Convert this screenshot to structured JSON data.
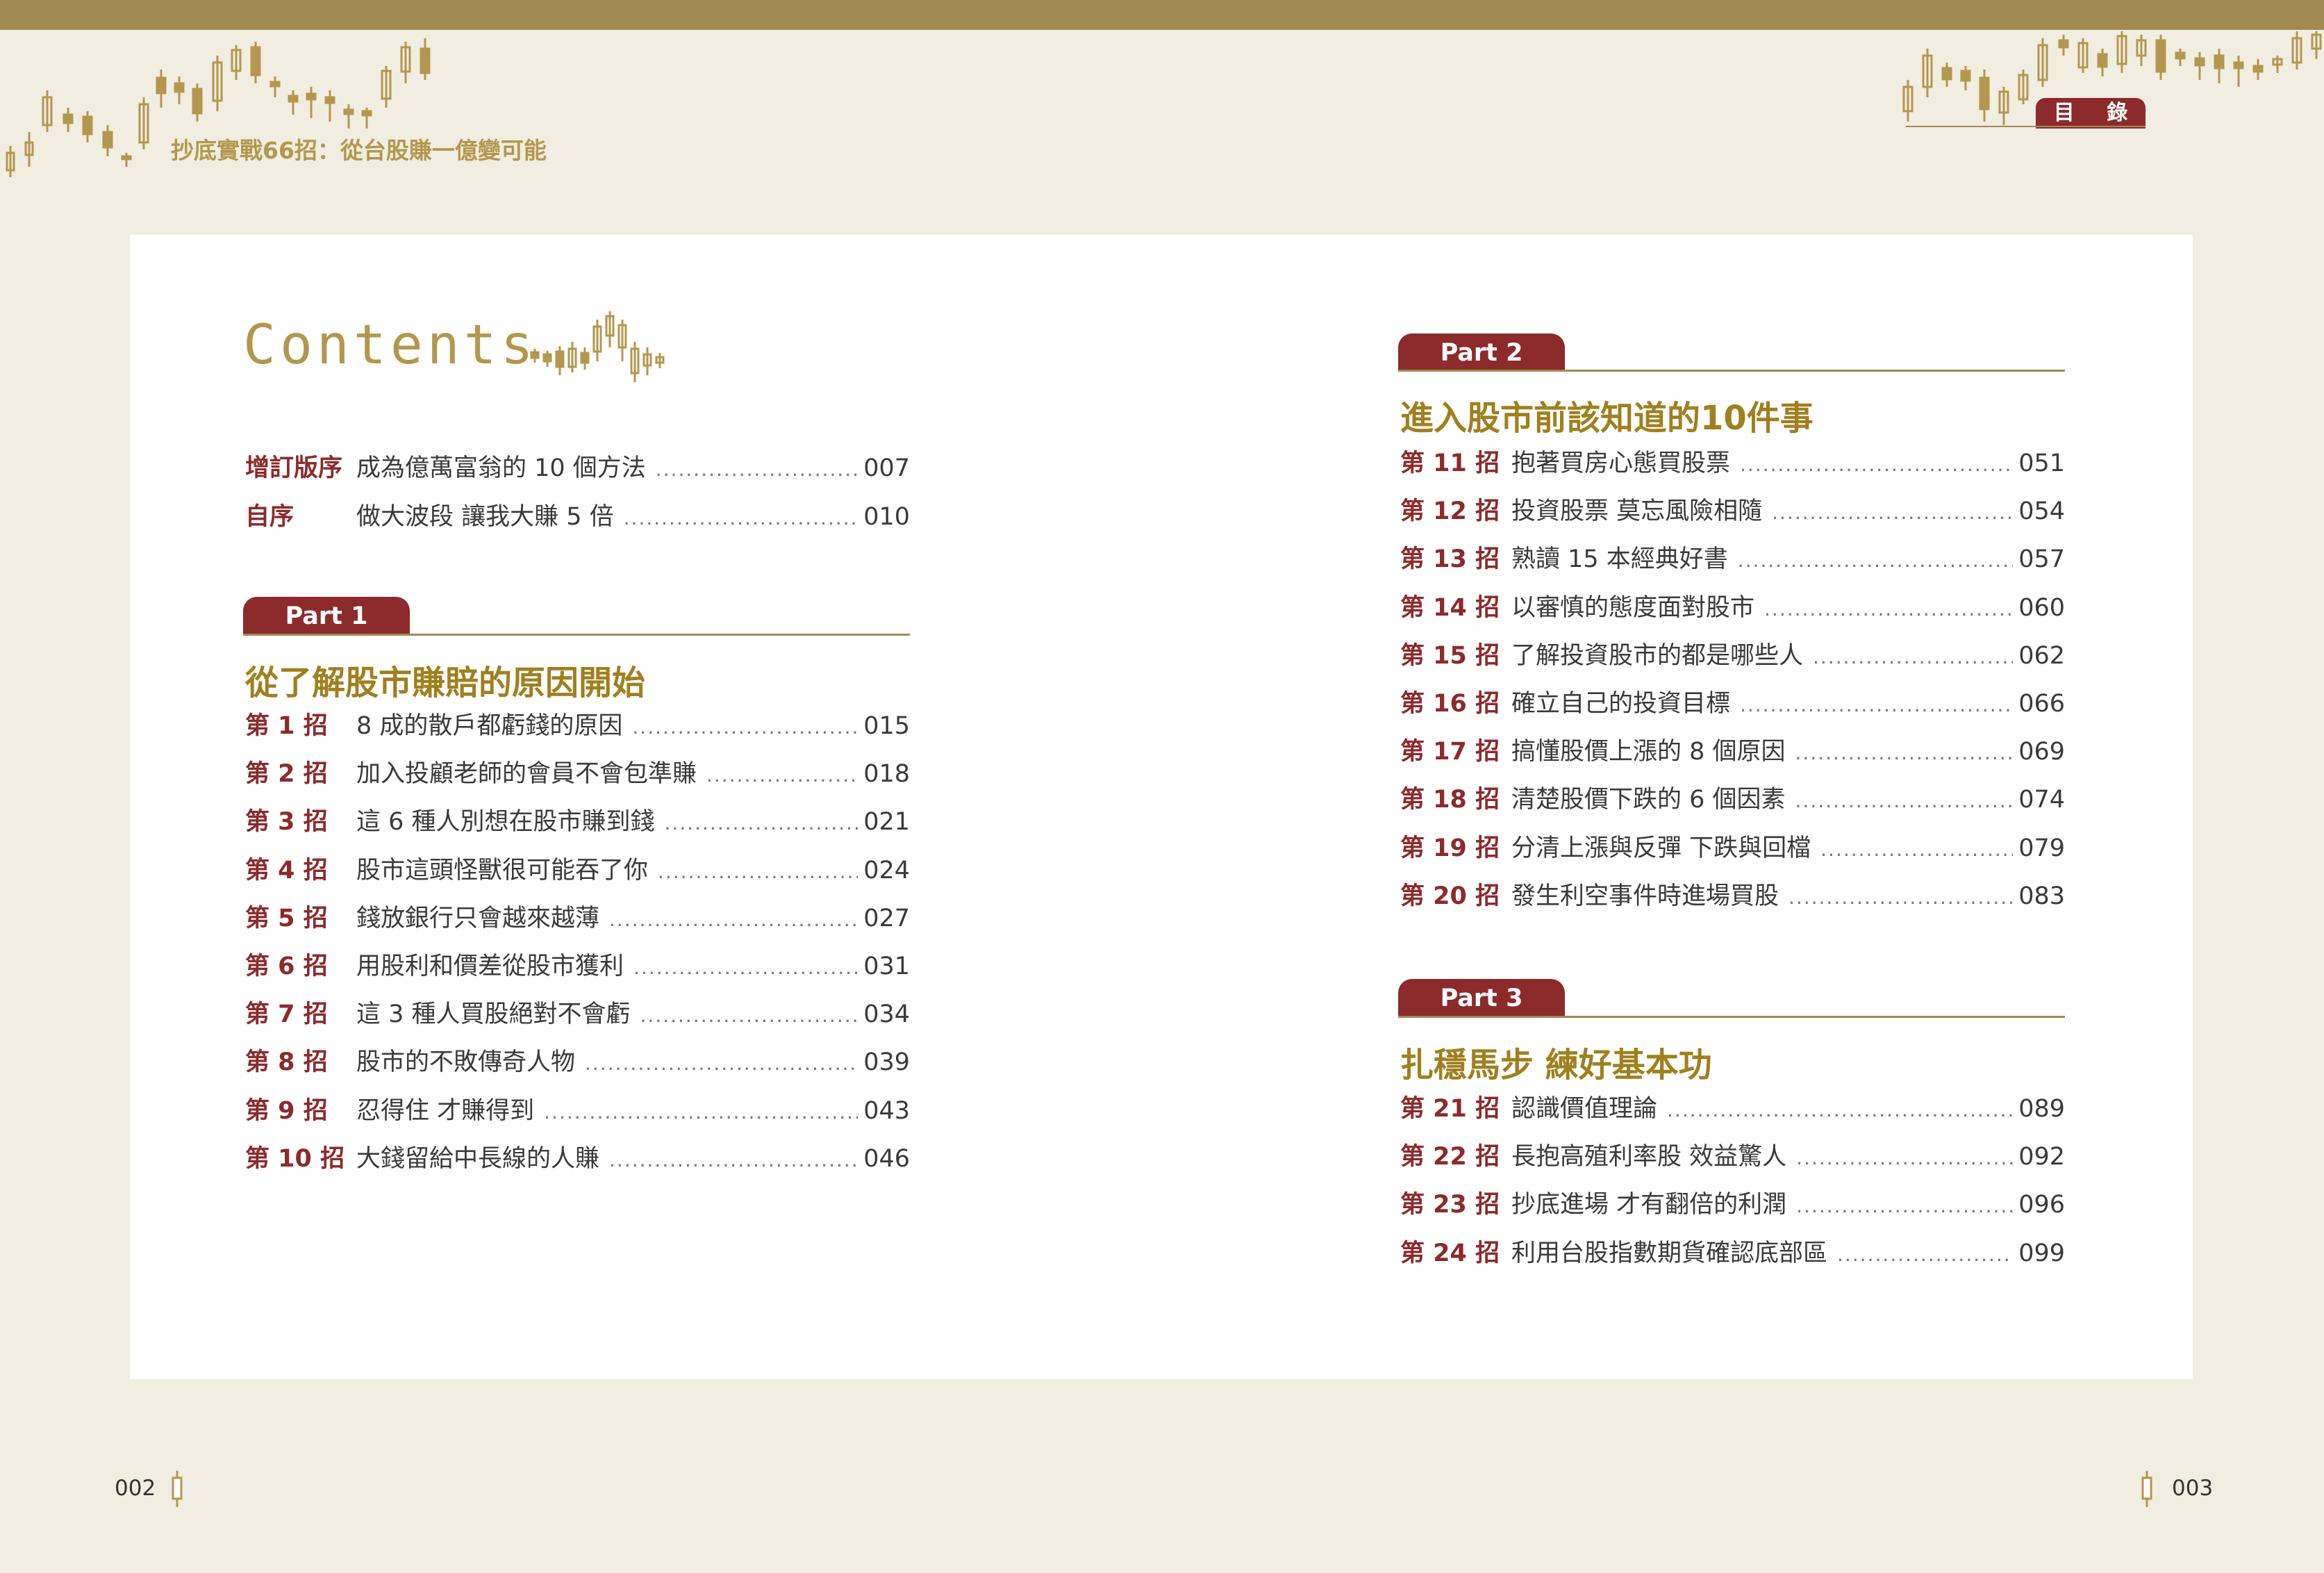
{
  "header": {
    "book_title": "抄底實戰66招：從台股賺一億變可能",
    "section_label": "目 錄"
  },
  "contents_title": "Contents",
  "preface": [
    {
      "label": "增訂版序",
      "title": "成為億萬富翁的 10 個方法",
      "page": "007"
    },
    {
      "label": "自序",
      "title": "做大波段 讓我大賺 5 倍",
      "page": "010"
    }
  ],
  "parts": [
    {
      "tab": "Part 1",
      "title": "從了解股市賺賠的原因開始",
      "entries": [
        {
          "label": "第 1 招",
          "title": "8 成的散戶都虧錢的原因",
          "page": "015"
        },
        {
          "label": "第 2 招",
          "title": "加入投顧老師的會員不會包準賺",
          "page": "018"
        },
        {
          "label": "第 3 招",
          "title": "這 6 種人別想在股市賺到錢",
          "page": "021"
        },
        {
          "label": "第 4 招",
          "title": "股市這頭怪獸很可能吞了你",
          "page": "024"
        },
        {
          "label": "第 5 招",
          "title": "錢放銀行只會越來越薄",
          "page": "027"
        },
        {
          "label": "第 6 招",
          "title": "用股利和價差從股市獲利",
          "page": "031"
        },
        {
          "label": "第 7 招",
          "title": "這 3 種人買股絕對不會虧",
          "page": "034"
        },
        {
          "label": "第 8 招",
          "title": "股市的不敗傳奇人物",
          "page": "039"
        },
        {
          "label": "第 9 招",
          "title": "忍得住 才賺得到",
          "page": "043"
        },
        {
          "label": "第 10 招",
          "title": "大錢留給中長線的人賺",
          "page": "046"
        }
      ]
    },
    {
      "tab": "Part 2",
      "title": "進入股市前該知道的10件事",
      "entries": [
        {
          "label": "第 11 招",
          "title": "抱著買房心態買股票",
          "page": "051"
        },
        {
          "label": "第 12 招",
          "title": "投資股票 莫忘風險相隨",
          "page": "054"
        },
        {
          "label": "第 13 招",
          "title": "熟讀 15 本經典好書",
          "page": "057"
        },
        {
          "label": "第 14 招",
          "title": "以審慎的態度面對股市",
          "page": "060"
        },
        {
          "label": "第 15 招",
          "title": "了解投資股市的都是哪些人",
          "page": "062"
        },
        {
          "label": "第 16 招",
          "title": "確立自己的投資目標",
          "page": "066"
        },
        {
          "label": "第 17 招",
          "title": "搞懂股價上漲的 8 個原因",
          "page": "069"
        },
        {
          "label": "第 18 招",
          "title": "清楚股價下跌的 6 個因素",
          "page": "074"
        },
        {
          "label": "第 19 招",
          "title": "分清上漲與反彈 下跌與回檔",
          "page": "079"
        },
        {
          "label": "第 20 招",
          "title": "發生利空事件時進場買股",
          "page": "083"
        }
      ]
    },
    {
      "tab": "Part 3",
      "title": "扎穩馬步 練好基本功",
      "entries": [
        {
          "label": "第 21 招",
          "title": "認識價值理論",
          "page": "089"
        },
        {
          "label": "第 22 招",
          "title": "長抱高殖利率股 效益驚人",
          "page": "092"
        },
        {
          "label": "第 23 招",
          "title": "抄底進場 才有翻倍的利潤",
          "page": "096"
        },
        {
          "label": "第 24 招",
          "title": "利用台股指數期貨確認底部區",
          "page": "099"
        }
      ]
    }
  ],
  "folios": {
    "left": "002",
    "right": "003"
  },
  "colors": {
    "background": "#f1ede1",
    "top_bar": "#a08b52",
    "accent_red": "#8c2a2c",
    "gold_title": "#a07f1e",
    "candle_gold": "#b3974e"
  },
  "icons": [
    "candlestick-decoration",
    "candlestick-icon"
  ]
}
